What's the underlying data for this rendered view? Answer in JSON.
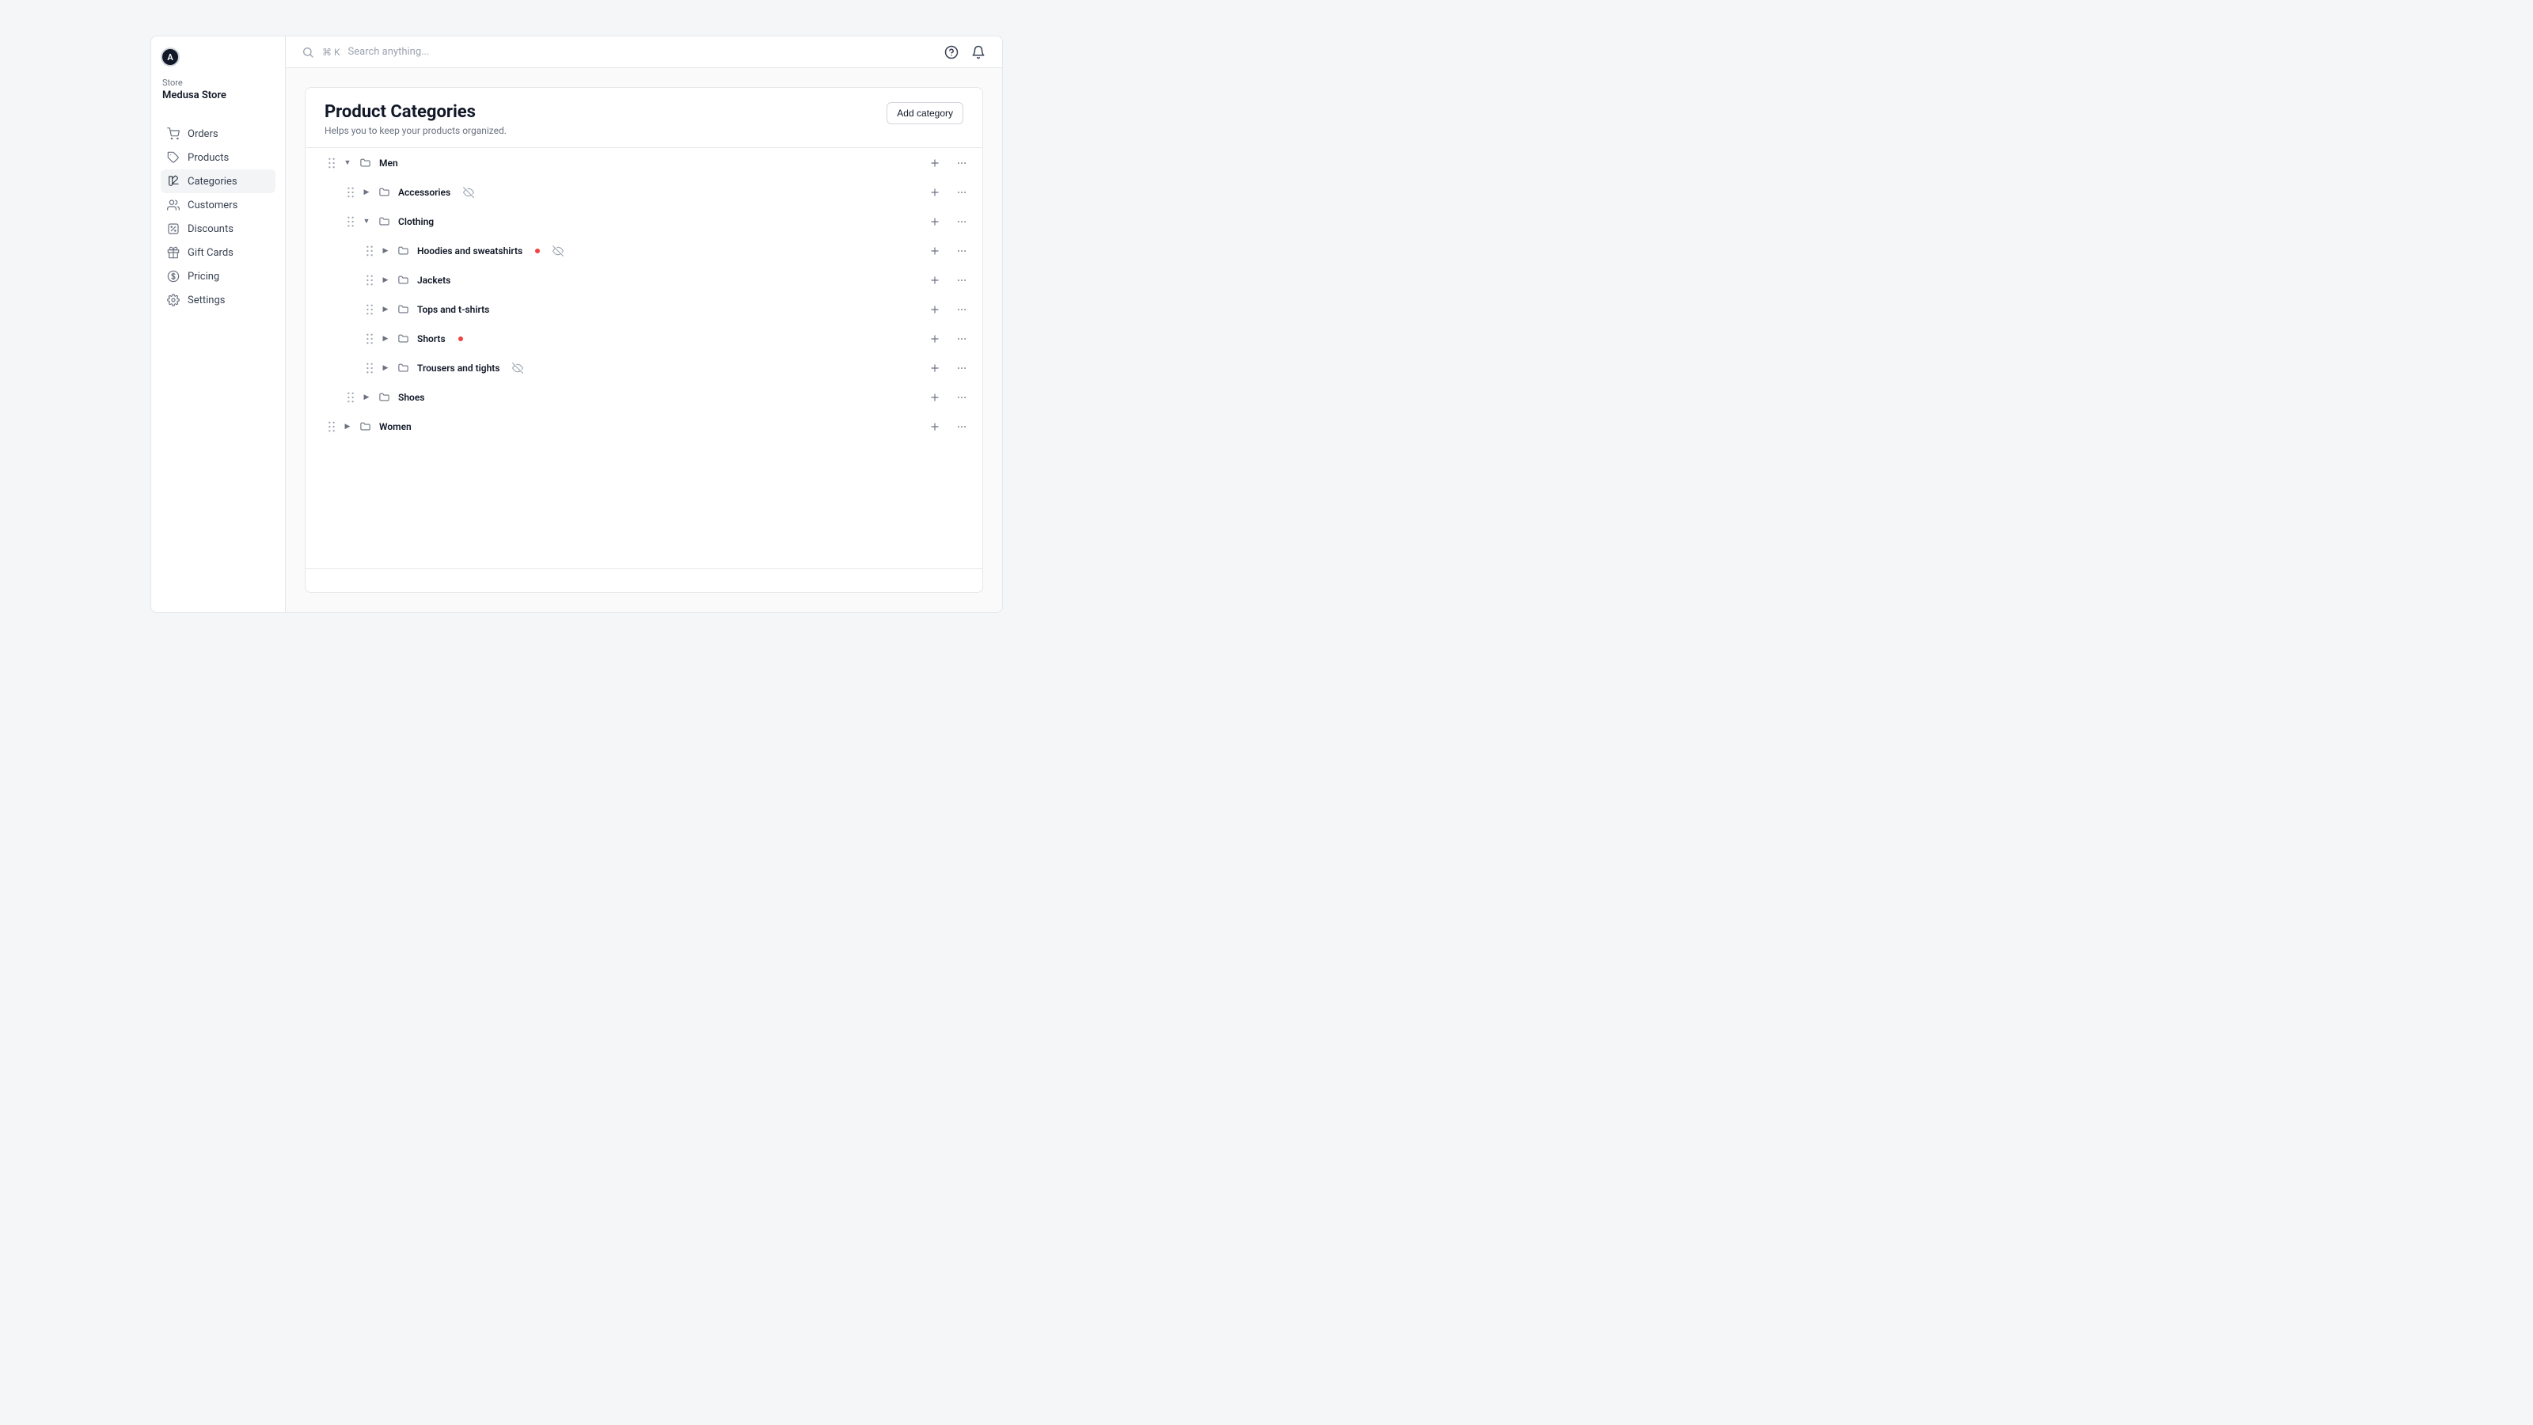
{
  "avatar_letter": "A",
  "store_label": "Store",
  "store_name": "Medusa Store",
  "sidebar": {
    "items": [
      {
        "icon": "cart",
        "label": "Orders"
      },
      {
        "icon": "tag",
        "label": "Products"
      },
      {
        "icon": "swatch",
        "label": "Categories",
        "active": true
      },
      {
        "icon": "users",
        "label": "Customers"
      },
      {
        "icon": "percent",
        "label": "Discounts"
      },
      {
        "icon": "gift",
        "label": "Gift Cards"
      },
      {
        "icon": "dollar",
        "label": "Pricing"
      },
      {
        "icon": "gear",
        "label": "Settings"
      }
    ]
  },
  "search": {
    "shortcut": "⌘ K",
    "placeholder": "Search anything..."
  },
  "page": {
    "title": "Product Categories",
    "subtitle": "Helps you to keep your products organized.",
    "add_button": "Add category"
  },
  "tree": [
    {
      "depth": 0,
      "label": "Men",
      "expanded": true
    },
    {
      "depth": 1,
      "label": "Accessories",
      "expanded": false,
      "hidden": true
    },
    {
      "depth": 1,
      "label": "Clothing",
      "expanded": true
    },
    {
      "depth": 2,
      "label": "Hoodies and sweatshirts",
      "expanded": false,
      "status_dot": true,
      "hidden": true
    },
    {
      "depth": 2,
      "label": "Jackets",
      "expanded": false
    },
    {
      "depth": 2,
      "label": "Tops and t-shirts",
      "expanded": false
    },
    {
      "depth": 2,
      "label": "Shorts",
      "expanded": false,
      "status_dot": true
    },
    {
      "depth": 2,
      "label": "Trousers and tights",
      "expanded": false,
      "hidden": true
    },
    {
      "depth": 1,
      "label": "Shoes",
      "expanded": false
    },
    {
      "depth": 0,
      "label": "Women",
      "expanded": false
    }
  ]
}
